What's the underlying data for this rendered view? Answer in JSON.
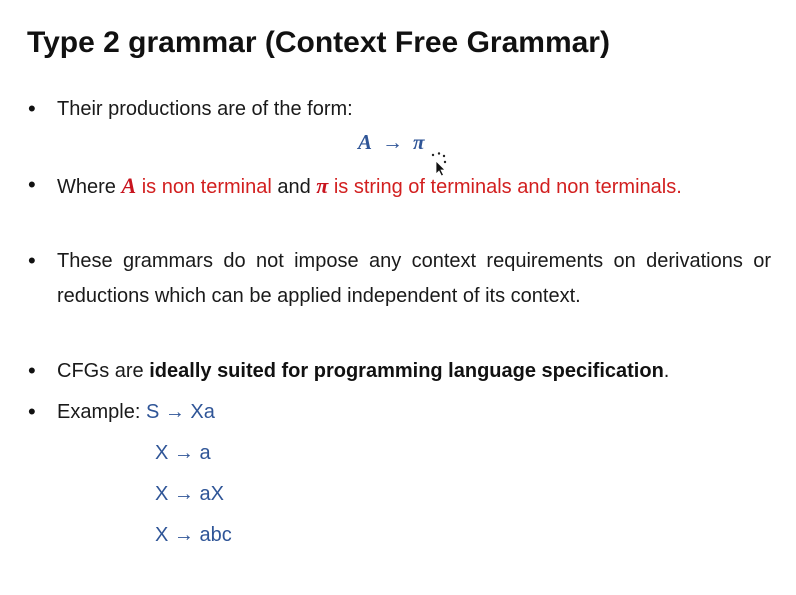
{
  "slide": {
    "title": "Type 2 grammar (Context Free Grammar)",
    "bullets": {
      "b1": "Their productions are of the form:",
      "formula": {
        "lhs": "A",
        "arrow": "→",
        "rhs": "π"
      },
      "b2": {
        "where": "Where ",
        "a": "A",
        "is_non_terminal": " is non terminal",
        "and": " and ",
        "pi": "π",
        "rest": " is string of terminals and non terminals."
      },
      "b3": "These grammars do not impose any context requirements on derivations or reductions which can be applied independent of its context.",
      "b4": {
        "pre": "CFGs are ",
        "bold": "ideally suited for programming language specification",
        "post": "."
      },
      "b5": {
        "label": "Example: ",
        "first": "S → Xa",
        "rest": [
          "X → a",
          "X → aX",
          "X → abc"
        ]
      }
    },
    "bullet_glyph": "•"
  },
  "colors": {
    "blue": "#2f5597",
    "red": "#d21f1f",
    "text": "#1a1a1a"
  },
  "icons": [
    "bullet-dot-icon",
    "mouse-cursor-icon"
  ]
}
